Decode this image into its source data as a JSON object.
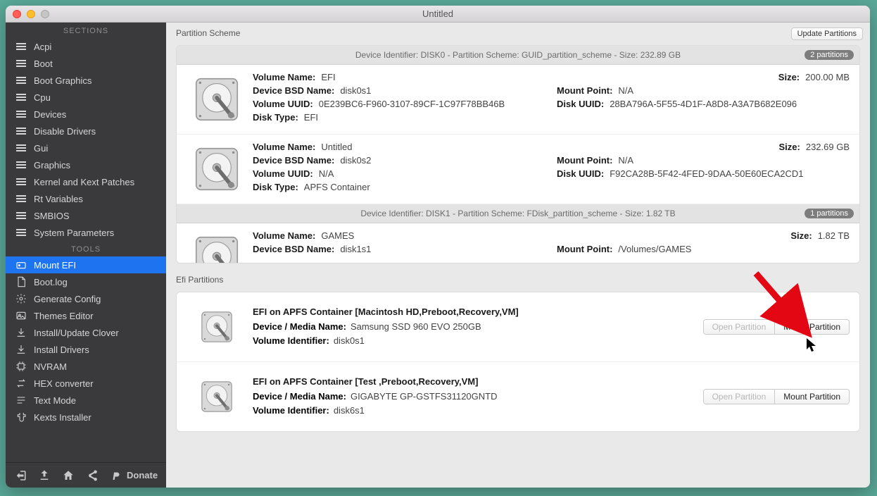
{
  "window": {
    "title": "Untitled"
  },
  "sidebar": {
    "sections_label": "SECTIONS",
    "tools_label": "TOOLS",
    "sections": [
      {
        "label": "Acpi",
        "icon": "list"
      },
      {
        "label": "Boot",
        "icon": "list"
      },
      {
        "label": "Boot Graphics",
        "icon": "list"
      },
      {
        "label": "Cpu",
        "icon": "list"
      },
      {
        "label": "Devices",
        "icon": "list"
      },
      {
        "label": "Disable Drivers",
        "icon": "list"
      },
      {
        "label": "Gui",
        "icon": "list"
      },
      {
        "label": "Graphics",
        "icon": "list"
      },
      {
        "label": "Kernel and Kext Patches",
        "icon": "list"
      },
      {
        "label": "Rt Variables",
        "icon": "list"
      },
      {
        "label": "SMBIOS",
        "icon": "list"
      },
      {
        "label": "System Parameters",
        "icon": "list"
      }
    ],
    "tools": [
      {
        "label": "Mount EFI",
        "icon": "drive",
        "selected": true
      },
      {
        "label": "Boot.log",
        "icon": "doc"
      },
      {
        "label": "Generate Config",
        "icon": "gear"
      },
      {
        "label": "Themes Editor",
        "icon": "image"
      },
      {
        "label": "Install/Update Clover",
        "icon": "download"
      },
      {
        "label": "Install Drivers",
        "icon": "download"
      },
      {
        "label": "NVRAM",
        "icon": "chip"
      },
      {
        "label": "HEX converter",
        "icon": "swap"
      },
      {
        "label": "Text Mode",
        "icon": "text"
      },
      {
        "label": "Kexts Installer",
        "icon": "plugin"
      }
    ],
    "donate": "Donate"
  },
  "main": {
    "partition_scheme_label": "Partition Scheme",
    "efi_partitions_label": "Efi Partitions",
    "update_btn": "Update Partitions",
    "disks": [
      {
        "header": "Device Identifier: DISK0 - Partition Scheme: GUID_partition_scheme - Size: 232.89 GB",
        "badge": "2 partitions",
        "partitions": [
          {
            "volume_name": "EFI",
            "bsd_name": "disk0s1",
            "volume_uuid": "0E239BC6-F960-3107-89CF-1C97F78BB46B",
            "disk_type": "EFI",
            "size": "200.00 MB",
            "mount_point": "N/A",
            "disk_uuid": "28BA796A-5F55-4D1F-A8D8-A3A7B682E096"
          },
          {
            "volume_name": "Untitled",
            "bsd_name": "disk0s2",
            "volume_uuid": "N/A",
            "disk_type": "APFS Container",
            "size": "232.69 GB",
            "mount_point": "N/A",
            "disk_uuid": "F92CA28B-5F42-4FED-9DAA-50E60ECA2CD1"
          }
        ]
      },
      {
        "header": "Device Identifier: DISK1 - Partition Scheme: FDisk_partition_scheme - Size: 1.82 TB",
        "badge": "1 partitions",
        "partitions": [
          {
            "volume_name": "GAMES",
            "bsd_name": "disk1s1",
            "size": "1.82 TB",
            "mount_point": "/Volumes/GAMES"
          }
        ]
      }
    ],
    "labels": {
      "volume_name": "Volume Name:",
      "bsd_name": "Device BSD Name:",
      "volume_uuid": "Volume UUID:",
      "disk_type": "Disk Type:",
      "size": "Size:",
      "mount_point": "Mount Point:",
      "disk_uuid": "Disk UUID:",
      "device_media": "Device / Media Name:",
      "volume_identifier": "Volume Identifier:",
      "open_partition": "Open Partition",
      "mount_partition": "Mount Partition"
    },
    "efi_partitions": [
      {
        "title": "EFI on APFS Container [Macintosh HD,Preboot,Recovery,VM]",
        "media_name": "Samsung SSD 960 EVO 250GB",
        "volume_identifier": "disk0s1"
      },
      {
        "title": "EFI on APFS Container [Test ,Preboot,Recovery,VM]",
        "media_name": "GIGABYTE GP-GSTFS31120GNTD",
        "volume_identifier": "disk6s1"
      }
    ]
  }
}
